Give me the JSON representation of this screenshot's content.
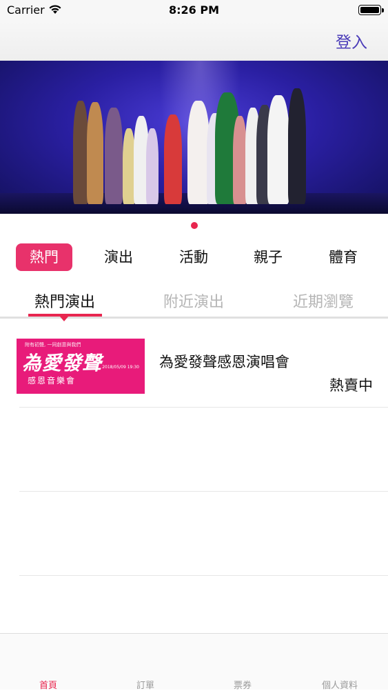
{
  "status_bar": {
    "carrier": "Carrier",
    "time": "8:26 PM"
  },
  "navbar": {
    "login_label": "登入"
  },
  "banner": {
    "page_count": 1,
    "current_page": 1
  },
  "categories": [
    {
      "label": "熱門",
      "active": true
    },
    {
      "label": "演出",
      "active": false
    },
    {
      "label": "活動",
      "active": false
    },
    {
      "label": "親子",
      "active": false
    },
    {
      "label": "體育",
      "active": false
    }
  ],
  "sub_tabs": [
    {
      "label": "熱門演出",
      "active": true
    },
    {
      "label": "附近演出",
      "active": false
    },
    {
      "label": "近期瀏覽",
      "active": false
    }
  ],
  "events": [
    {
      "title": "為愛發聲感恩演唱會",
      "status": "熱賣中",
      "thumbnail": {
        "top_line": "附有初聲, 一同創意與我們",
        "main": "為愛發聲",
        "date_line": "2018/05/09 19:30",
        "venue_line": "感恩音樂會",
        "sub_title": "感恩音樂會"
      }
    }
  ],
  "tab_bar": [
    {
      "label": "首頁",
      "active": true
    },
    {
      "label": "訂單",
      "active": false
    },
    {
      "label": "票券",
      "active": false
    },
    {
      "label": "個人資料",
      "active": false
    }
  ],
  "colors": {
    "accent": "#e8264f",
    "chip_active": "#e8326b",
    "login": "#4a3bb8",
    "thumb_bg": "#e81b7a"
  }
}
